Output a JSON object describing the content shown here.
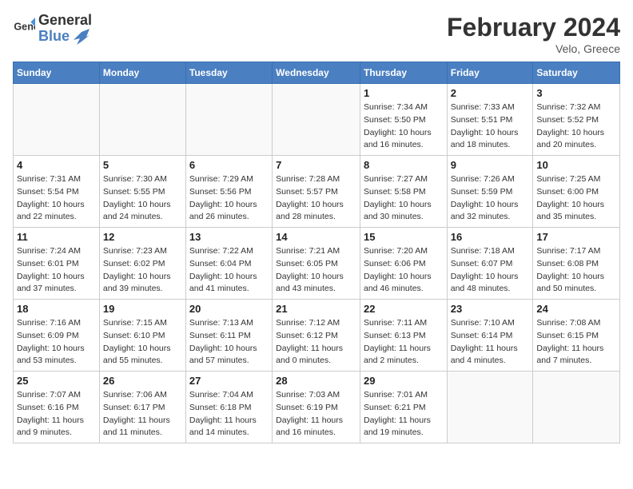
{
  "header": {
    "logo_general": "General",
    "logo_blue": "Blue",
    "title": "February 2024",
    "location": "Velo, Greece"
  },
  "days_of_week": [
    "Sunday",
    "Monday",
    "Tuesday",
    "Wednesday",
    "Thursday",
    "Friday",
    "Saturday"
  ],
  "weeks": [
    [
      {
        "day": "",
        "info": ""
      },
      {
        "day": "",
        "info": ""
      },
      {
        "day": "",
        "info": ""
      },
      {
        "day": "",
        "info": ""
      },
      {
        "day": "1",
        "info": "Sunrise: 7:34 AM\nSunset: 5:50 PM\nDaylight: 10 hours\nand 16 minutes."
      },
      {
        "day": "2",
        "info": "Sunrise: 7:33 AM\nSunset: 5:51 PM\nDaylight: 10 hours\nand 18 minutes."
      },
      {
        "day": "3",
        "info": "Sunrise: 7:32 AM\nSunset: 5:52 PM\nDaylight: 10 hours\nand 20 minutes."
      }
    ],
    [
      {
        "day": "4",
        "info": "Sunrise: 7:31 AM\nSunset: 5:54 PM\nDaylight: 10 hours\nand 22 minutes."
      },
      {
        "day": "5",
        "info": "Sunrise: 7:30 AM\nSunset: 5:55 PM\nDaylight: 10 hours\nand 24 minutes."
      },
      {
        "day": "6",
        "info": "Sunrise: 7:29 AM\nSunset: 5:56 PM\nDaylight: 10 hours\nand 26 minutes."
      },
      {
        "day": "7",
        "info": "Sunrise: 7:28 AM\nSunset: 5:57 PM\nDaylight: 10 hours\nand 28 minutes."
      },
      {
        "day": "8",
        "info": "Sunrise: 7:27 AM\nSunset: 5:58 PM\nDaylight: 10 hours\nand 30 minutes."
      },
      {
        "day": "9",
        "info": "Sunrise: 7:26 AM\nSunset: 5:59 PM\nDaylight: 10 hours\nand 32 minutes."
      },
      {
        "day": "10",
        "info": "Sunrise: 7:25 AM\nSunset: 6:00 PM\nDaylight: 10 hours\nand 35 minutes."
      }
    ],
    [
      {
        "day": "11",
        "info": "Sunrise: 7:24 AM\nSunset: 6:01 PM\nDaylight: 10 hours\nand 37 minutes."
      },
      {
        "day": "12",
        "info": "Sunrise: 7:23 AM\nSunset: 6:02 PM\nDaylight: 10 hours\nand 39 minutes."
      },
      {
        "day": "13",
        "info": "Sunrise: 7:22 AM\nSunset: 6:04 PM\nDaylight: 10 hours\nand 41 minutes."
      },
      {
        "day": "14",
        "info": "Sunrise: 7:21 AM\nSunset: 6:05 PM\nDaylight: 10 hours\nand 43 minutes."
      },
      {
        "day": "15",
        "info": "Sunrise: 7:20 AM\nSunset: 6:06 PM\nDaylight: 10 hours\nand 46 minutes."
      },
      {
        "day": "16",
        "info": "Sunrise: 7:18 AM\nSunset: 6:07 PM\nDaylight: 10 hours\nand 48 minutes."
      },
      {
        "day": "17",
        "info": "Sunrise: 7:17 AM\nSunset: 6:08 PM\nDaylight: 10 hours\nand 50 minutes."
      }
    ],
    [
      {
        "day": "18",
        "info": "Sunrise: 7:16 AM\nSunset: 6:09 PM\nDaylight: 10 hours\nand 53 minutes."
      },
      {
        "day": "19",
        "info": "Sunrise: 7:15 AM\nSunset: 6:10 PM\nDaylight: 10 hours\nand 55 minutes."
      },
      {
        "day": "20",
        "info": "Sunrise: 7:13 AM\nSunset: 6:11 PM\nDaylight: 10 hours\nand 57 minutes."
      },
      {
        "day": "21",
        "info": "Sunrise: 7:12 AM\nSunset: 6:12 PM\nDaylight: 11 hours\nand 0 minutes."
      },
      {
        "day": "22",
        "info": "Sunrise: 7:11 AM\nSunset: 6:13 PM\nDaylight: 11 hours\nand 2 minutes."
      },
      {
        "day": "23",
        "info": "Sunrise: 7:10 AM\nSunset: 6:14 PM\nDaylight: 11 hours\nand 4 minutes."
      },
      {
        "day": "24",
        "info": "Sunrise: 7:08 AM\nSunset: 6:15 PM\nDaylight: 11 hours\nand 7 minutes."
      }
    ],
    [
      {
        "day": "25",
        "info": "Sunrise: 7:07 AM\nSunset: 6:16 PM\nDaylight: 11 hours\nand 9 minutes."
      },
      {
        "day": "26",
        "info": "Sunrise: 7:06 AM\nSunset: 6:17 PM\nDaylight: 11 hours\nand 11 minutes."
      },
      {
        "day": "27",
        "info": "Sunrise: 7:04 AM\nSunset: 6:18 PM\nDaylight: 11 hours\nand 14 minutes."
      },
      {
        "day": "28",
        "info": "Sunrise: 7:03 AM\nSunset: 6:19 PM\nDaylight: 11 hours\nand 16 minutes."
      },
      {
        "day": "29",
        "info": "Sunrise: 7:01 AM\nSunset: 6:21 PM\nDaylight: 11 hours\nand 19 minutes."
      },
      {
        "day": "",
        "info": ""
      },
      {
        "day": "",
        "info": ""
      }
    ]
  ]
}
